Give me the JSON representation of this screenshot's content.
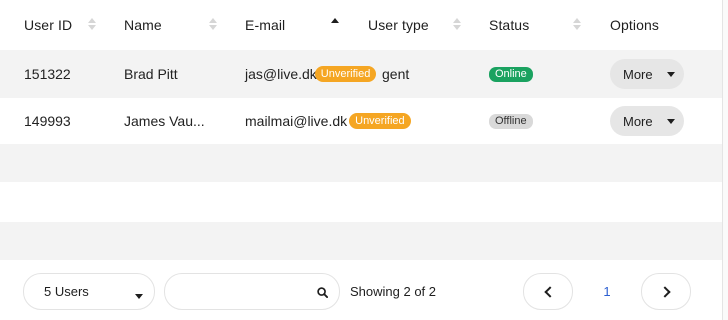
{
  "table": {
    "columns": [
      {
        "label": "User ID",
        "sort": "none"
      },
      {
        "label": "Name",
        "sort": "none"
      },
      {
        "label": "E-mail",
        "sort": "asc"
      },
      {
        "label": "User type",
        "sort": "none"
      },
      {
        "label": "Status",
        "sort": "none"
      },
      {
        "label": "Options",
        "sort": "none"
      }
    ],
    "rows": [
      {
        "user_id": "151322",
        "name": "Brad Pitt",
        "email": "jas@live.dk",
        "email_badge": "Unverified",
        "user_type": "gent",
        "status": "Online",
        "options_label": "More"
      },
      {
        "user_id": "149993",
        "name": "James Vau...",
        "email": "mailmai@live.dk",
        "email_badge": "Unverified",
        "user_type": "",
        "status": "Offline",
        "options_label": "More"
      }
    ]
  },
  "footer": {
    "page_size_label": "5 Users",
    "search_value": "",
    "showing_text": "Showing 2 of 2",
    "current_page": "1"
  },
  "colors": {
    "unverified": "#f5a623",
    "online": "#1aa260",
    "offline": "#d9d9d9",
    "page_link": "#2c5fd1"
  }
}
